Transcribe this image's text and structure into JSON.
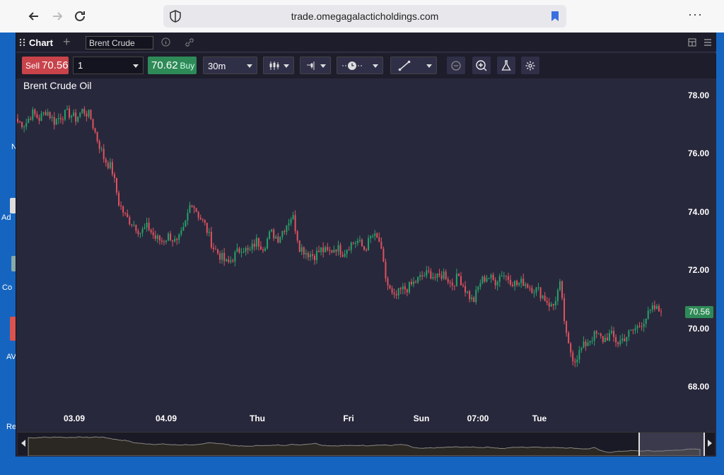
{
  "browser": {
    "url": "trade.omegagalacticholdings.com",
    "menu_label": "···"
  },
  "desktop": {
    "labels": [
      "N",
      "Ad",
      "Co",
      "AV",
      "Re"
    ]
  },
  "tabbar": {
    "chart_tab": "Chart",
    "symbol": "Brent Crude"
  },
  "toolbar": {
    "sell_label": "Sell",
    "sell_price": "70.56",
    "quantity": "1",
    "buy_price": "70.62",
    "buy_label": "Buy",
    "timeframe": "30m"
  },
  "chart_data": {
    "type": "candlestick",
    "title": "Brent Crude Oil",
    "ylim": [
      67.5,
      78.4
    ],
    "y_ticks": [
      "78.00",
      "76.00",
      "74.00",
      "72.00",
      "70.00",
      "68.00"
    ],
    "x_ticks": [
      "03.09",
      "04.09",
      "Thu",
      "Fri",
      "Sun",
      "07:00",
      "Tue"
    ],
    "current_price": "70.56",
    "up_color": "#26a269",
    "down_color": "#e0525e",
    "series": [
      {
        "values": [
          77.1,
          77.0,
          77.4,
          77.2,
          77.5,
          77.1,
          77.3,
          77.4,
          77.2,
          77.5
        ]
      },
      {
        "values": [
          77.3,
          76.5,
          75.8,
          75.5,
          74.3,
          73.8,
          73.6,
          73.3,
          73.5,
          73.1
        ]
      },
      {
        "values": [
          73.0,
          73.2,
          72.9,
          73.4,
          74.4,
          73.9,
          73.5,
          72.8,
          72.5,
          72.2
        ]
      },
      {
        "values": [
          72.5,
          72.8,
          72.6,
          73.0,
          72.8,
          73.3,
          73.1,
          73.5,
          73.9,
          72.8
        ]
      },
      {
        "values": [
          72.6,
          72.5,
          72.7,
          72.6,
          72.8,
          72.6,
          72.9,
          73.0,
          72.7,
          73.2
        ]
      },
      {
        "values": [
          73.0,
          71.6,
          71.0,
          71.3,
          71.4,
          71.6,
          71.8,
          71.9,
          71.7,
          71.9
        ]
      },
      {
        "values": [
          71.5,
          71.8,
          71.3,
          70.9,
          71.6,
          71.8,
          71.6,
          71.9,
          71.7,
          71.5
        ]
      },
      {
        "values": [
          71.6,
          71.4,
          71.3,
          71.0,
          70.7,
          71.5,
          69.5,
          68.9,
          69.3,
          69.6
        ]
      },
      {
        "values": [
          69.8,
          69.6,
          69.8,
          69.5,
          69.7,
          69.9,
          70.1,
          70.4,
          70.7,
          70.56
        ]
      }
    ]
  }
}
